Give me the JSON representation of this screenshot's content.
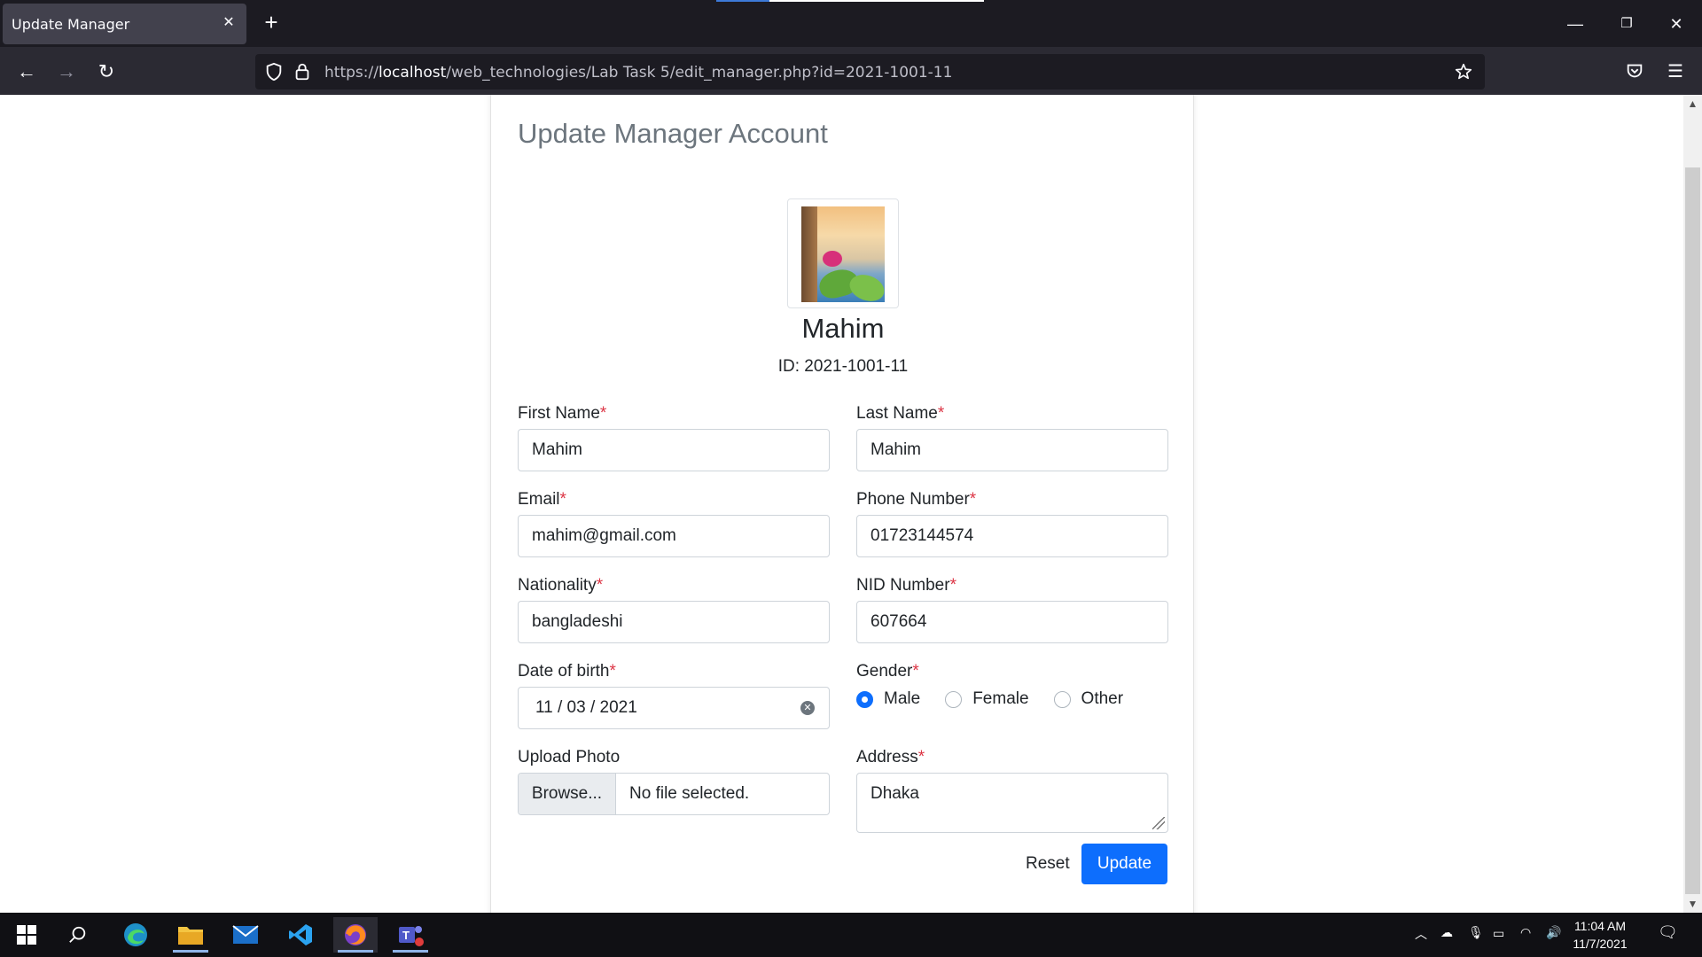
{
  "browser": {
    "tab_title": "Update Manager",
    "url_scheme": "https://",
    "url_host": "localhost",
    "url_path": "/web_technologies/Lab Task 5/edit_manager.php?id=2021-1001-11"
  },
  "page": {
    "title": "Update Manager Account",
    "profile_name": "Mahim",
    "profile_id": "ID: 2021-1001-11"
  },
  "form": {
    "first_name": {
      "label": "First Name",
      "required": "*",
      "value": "Mahim"
    },
    "last_name": {
      "label": "Last Name",
      "required": "*",
      "value": "Mahim"
    },
    "email": {
      "label": "Email",
      "required": "*",
      "value": "mahim@gmail.com"
    },
    "phone": {
      "label": "Phone Number",
      "required": "*",
      "value": "01723144574"
    },
    "nationality": {
      "label": "Nationality",
      "required": "*",
      "value": "bangladeshi"
    },
    "nid": {
      "label": "NID Number",
      "required": "*",
      "value": "607664"
    },
    "dob": {
      "label": "Date of birth",
      "required": "*",
      "value": "11 / 03 / 2021"
    },
    "gender": {
      "label": "Gender",
      "required": "*",
      "options": [
        "Male",
        "Female",
        "Other"
      ],
      "selected": "Male"
    },
    "photo": {
      "label": "Upload Photo",
      "button": "Browse...",
      "status": "No file selected."
    },
    "address": {
      "label": "Address",
      "required": "*",
      "value": "Dhaka"
    },
    "reset_label": "Reset",
    "update_label": "Update"
  },
  "taskbar": {
    "time": "11:04 AM",
    "date": "11/7/2021"
  },
  "colors": {
    "primary": "#0d6efd",
    "required": "#dc3545",
    "title_gray": "#6c757d"
  }
}
